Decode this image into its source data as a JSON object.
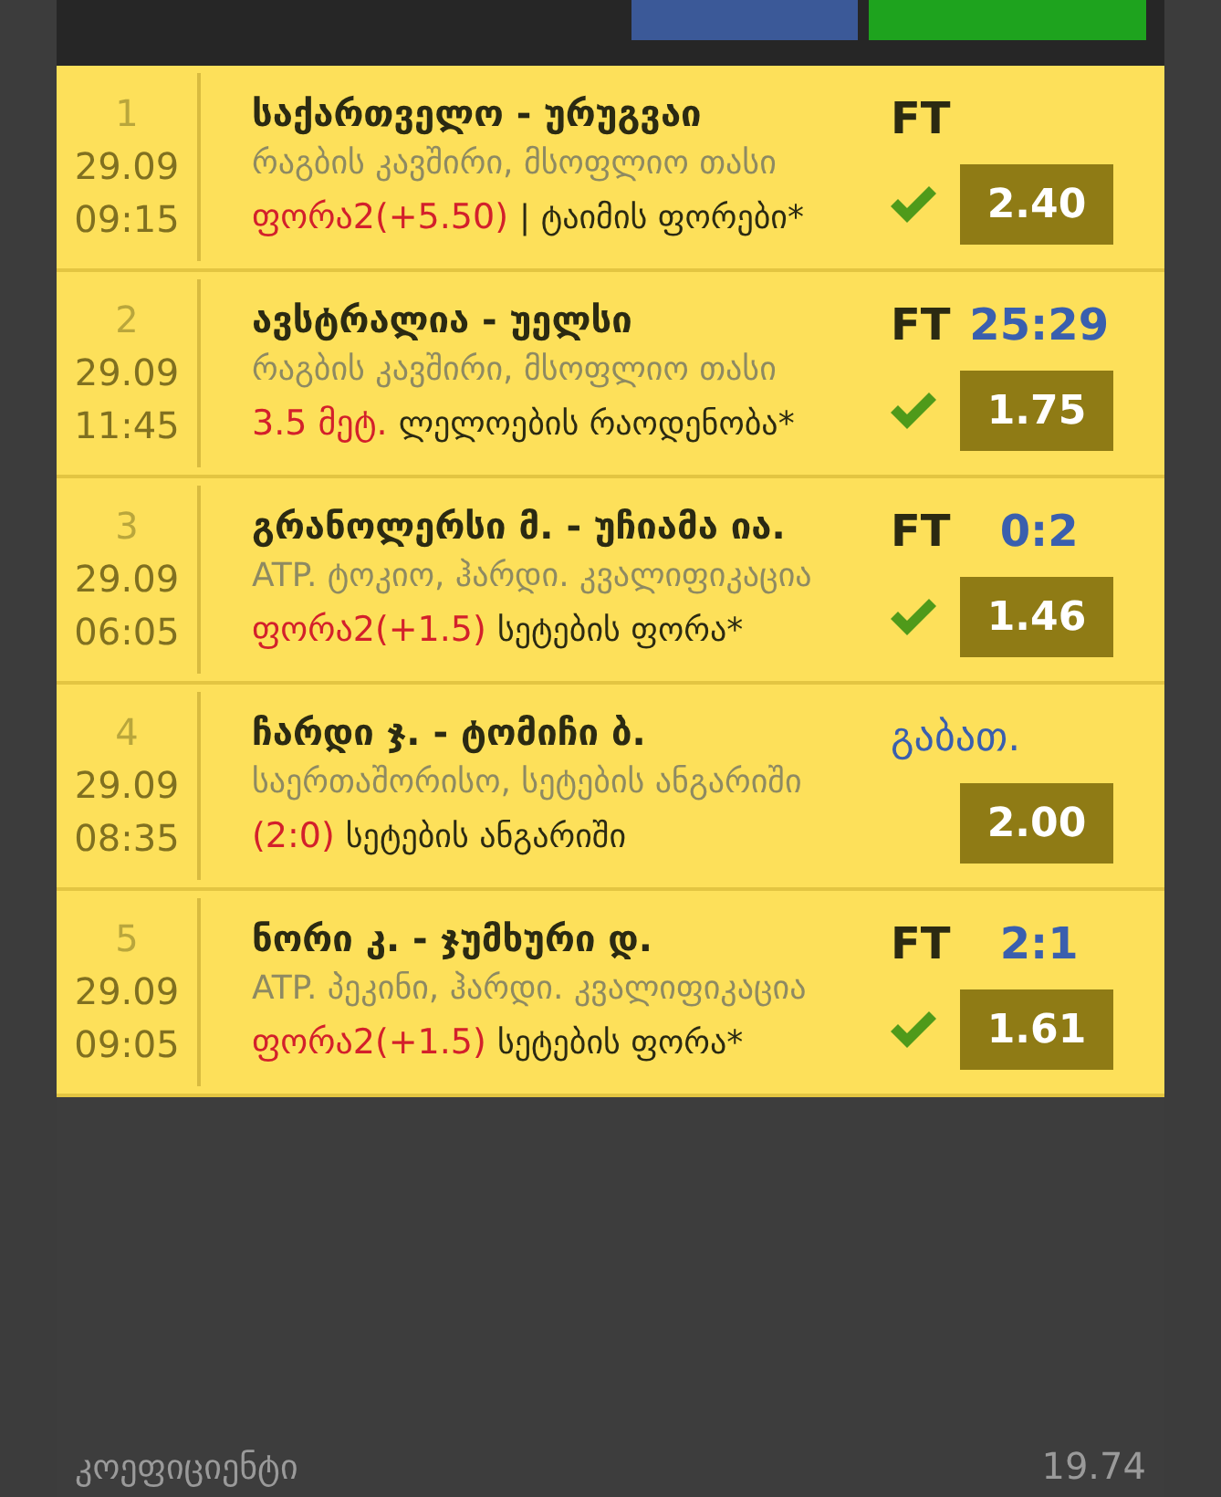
{
  "header": {
    "share_button": {
      "kind": "facebook"
    },
    "green_button": {
      "kind": "action"
    }
  },
  "events": [
    {
      "index": "1",
      "date": "29.09",
      "time": "09:15",
      "title": "საქართველო - ურუგვაი",
      "league": "რაგბის კავშირი, მსოფლიო თასი",
      "pick": "ფორა2(+5.50)",
      "market": "| ტაიმის ფორები*",
      "kind": "finished",
      "status": "FT",
      "odds": "2.40",
      "won": true
    },
    {
      "index": "2",
      "date": "29.09",
      "time": "11:45",
      "title": "ავსტრალია - უელსი",
      "league": "რაგბის კავშირი, მსოფლიო თასი",
      "pick": "3.5 მეტ.",
      "market": "ლელოების რაოდენობა*",
      "kind": "finished",
      "status": "FT",
      "score": "25:29",
      "odds": "1.75",
      "won": true
    },
    {
      "index": "3",
      "date": "29.09",
      "time": "06:05",
      "title": "გრანოლერსი მ. - უჩიამა ია.",
      "league": "ATP. ტოკიო, ჰარდი. კვალიფიკაცია",
      "pick": "ფორა2(+1.5)",
      "market": "სეტების ფორა*",
      "kind": "finished",
      "status": "FT",
      "score": "0:2",
      "odds": "1.46",
      "won": true
    },
    {
      "index": "4",
      "date": "29.09",
      "time": "08:35",
      "title": "ჩარდი ჯ. - ტომიჩი ბ.",
      "league": "საერთაშორისო, სეტების ანგარიში",
      "pick": "(2:0)",
      "market": "სეტების ანგარიში",
      "kind": "cancelled",
      "status": "გაბათ.",
      "odds": "2.00",
      "won": false
    },
    {
      "index": "5",
      "date": "29.09",
      "time": "09:05",
      "title": "ნორი კ. - ჯუმხური დ.",
      "league": "ATP. პეკინი, ჰარდი. კვალიფიკაცია",
      "pick": "ფორა2(+1.5)",
      "market": "სეტების ფორა*",
      "kind": "finished",
      "status": "FT",
      "score": "2:1",
      "odds": "1.61",
      "won": true
    }
  ],
  "footer": {
    "label": "კოეფიციენტი",
    "value": "19.74"
  }
}
